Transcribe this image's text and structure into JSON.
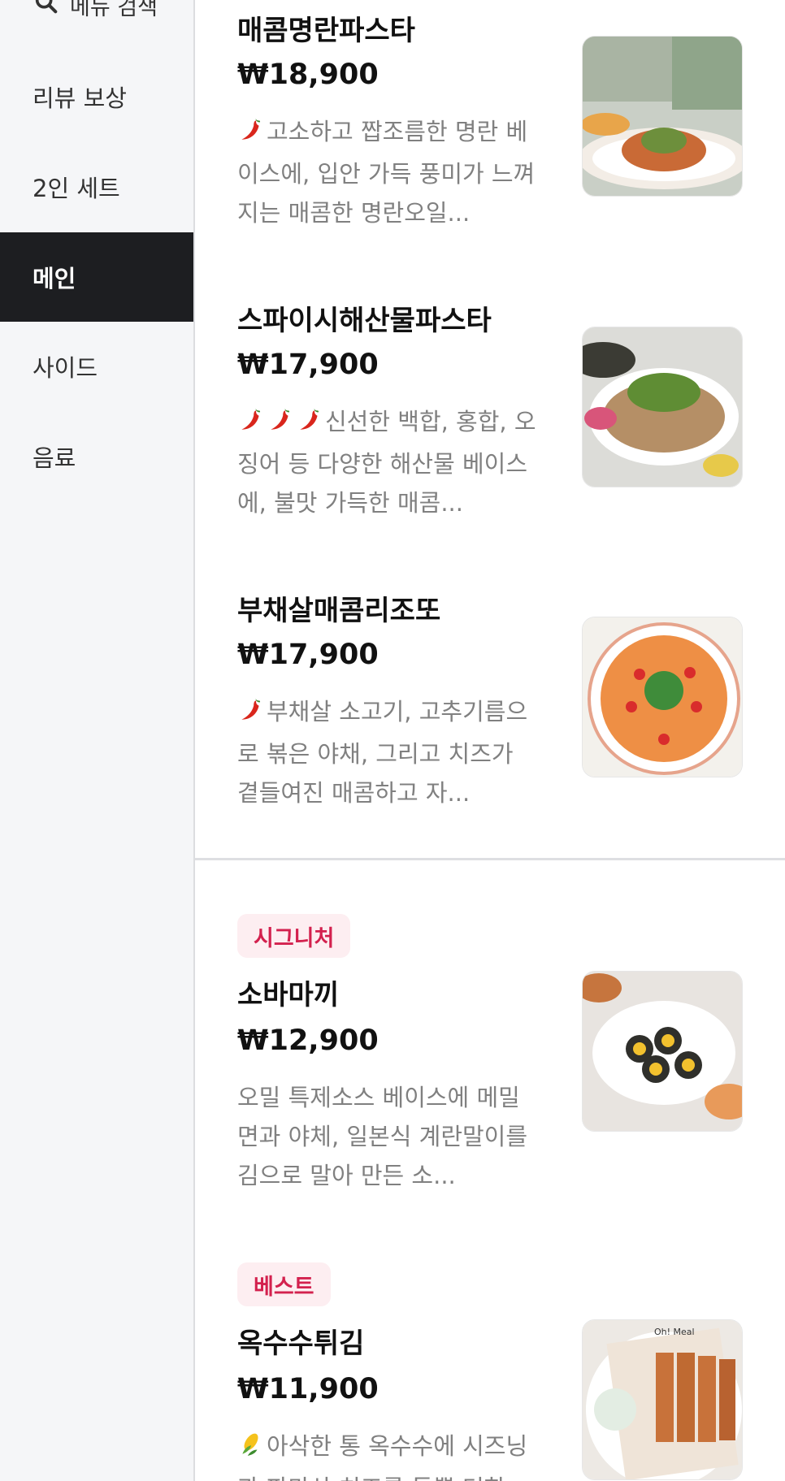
{
  "sidebar": {
    "search_label": "메뉴 검색",
    "items": [
      {
        "label": "리뷰 보상",
        "active": false
      },
      {
        "label": "2인 세트",
        "active": false
      },
      {
        "label": "메인",
        "active": true
      },
      {
        "label": "사이드",
        "active": false
      },
      {
        "label": "음료",
        "active": false
      }
    ]
  },
  "menu": {
    "items": [
      {
        "name": "매콤명란파스타",
        "price": "₩18,900",
        "description": "고소하고 짭조름한 명란 베이스에, 입안 가득 풍미가 느껴지는 매콤한 명란오일...",
        "spice_icons": [
          "chili-pepper-icon"
        ],
        "badge": ""
      },
      {
        "name": "스파이시해산물파스타",
        "price": "₩17,900",
        "description": "신선한 백합, 홍합, 오징어 등 다양한 해산물 베이스에, 불맛 가득한 매콤...",
        "spice_icons": [
          "chili-pepper-icon",
          "chili-pepper-icon",
          "chili-pepper-icon"
        ],
        "badge": ""
      },
      {
        "name": "부채살매콤리조또",
        "price": "₩17,900",
        "description": "부채살 소고기, 고추기름으로 볶은 야채, 그리고 치즈가 곁들여진 매콤하고 자...",
        "spice_icons": [
          "chili-pepper-icon"
        ],
        "badge": ""
      },
      {
        "name": "소바마끼",
        "price": "₩12,900",
        "description": "오밀 특제소스 베이스에 메밀면과 야체, 일본식 계란말이를 김으로 말아 만든 소...",
        "spice_icons": [],
        "badge": "시그니처"
      },
      {
        "name": "옥수수튀김",
        "price": "₩11,900",
        "description": "아삭한 통 옥수수에 시즈닝과 파마산 치즈를 듬뿍 더한",
        "spice_icons": [
          "corn-icon"
        ],
        "badge": "베스트"
      }
    ]
  },
  "colors": {
    "sidebar_bg": "#f5f6f8",
    "sidebar_active_bg": "#1d1e21",
    "badge_bg": "#fdeef1",
    "badge_text": "#d3214e",
    "description_text": "#808080"
  }
}
